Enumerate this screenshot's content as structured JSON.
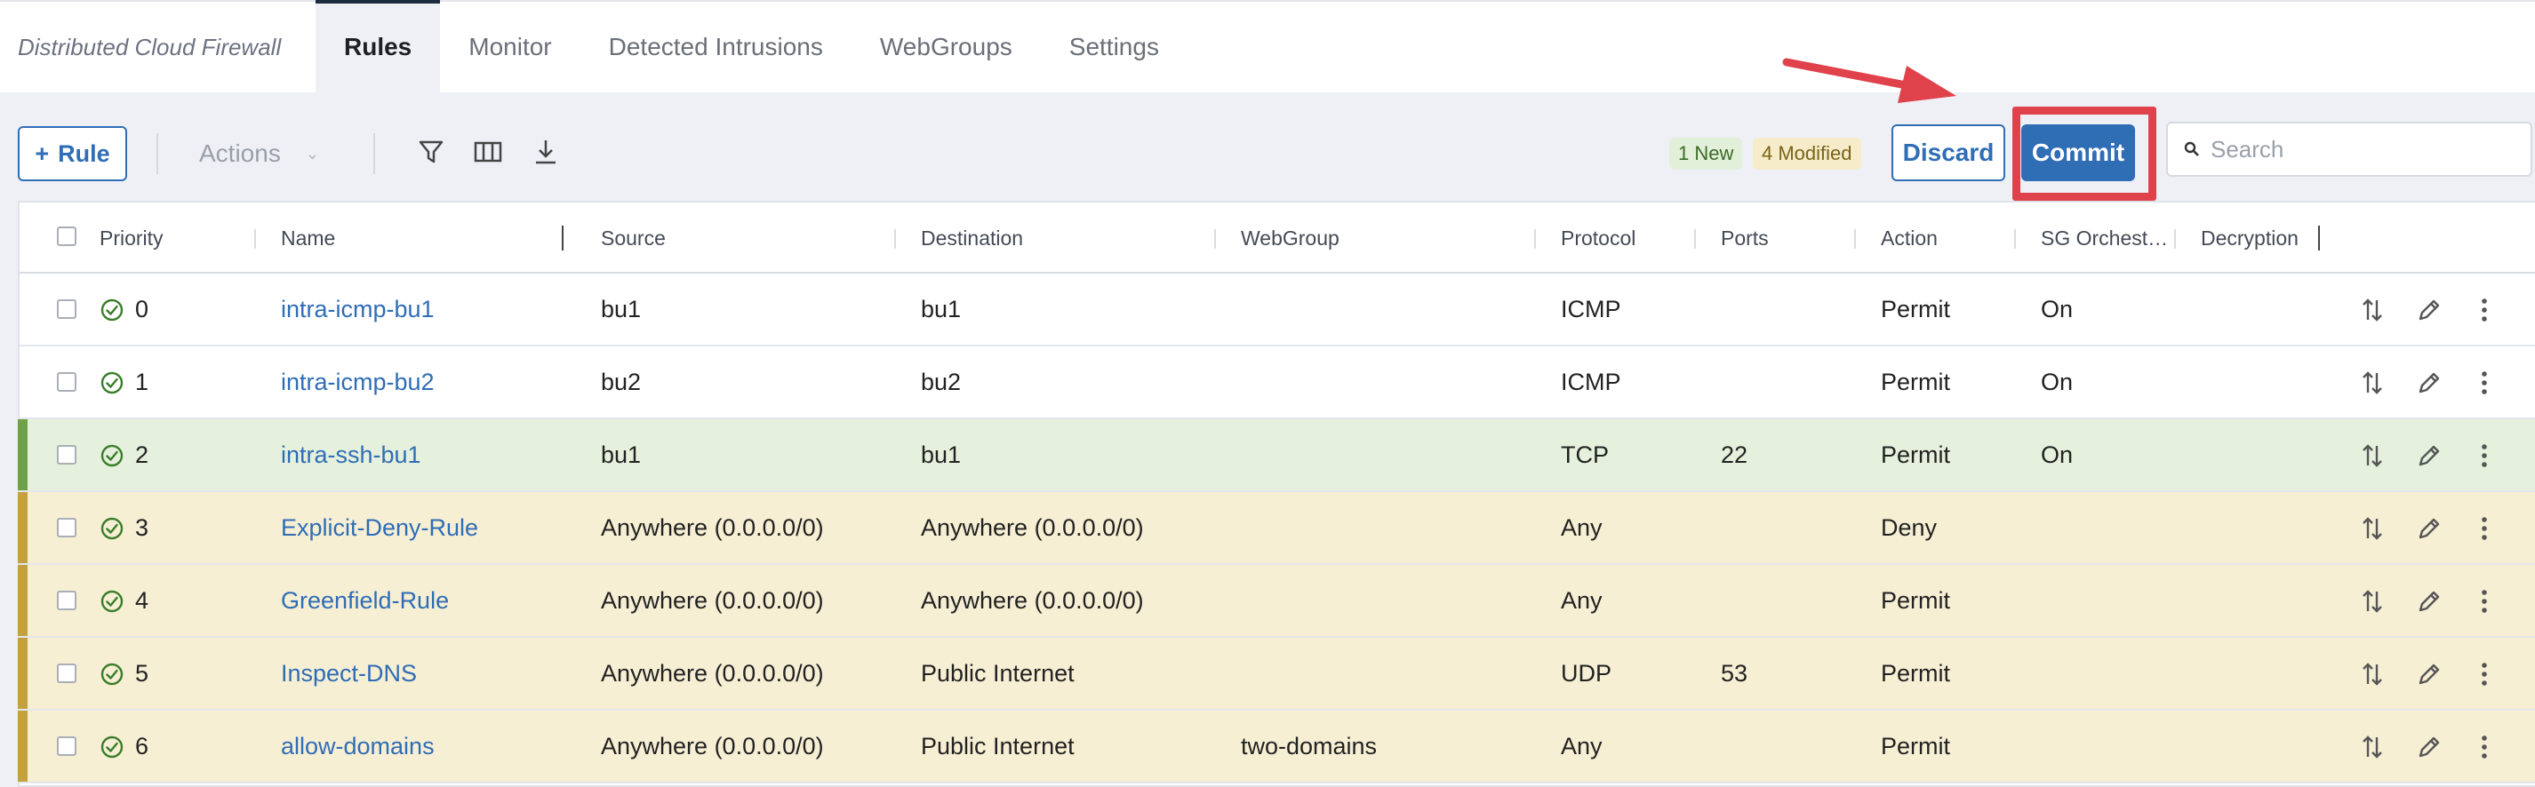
{
  "nav": {
    "brand": "Distributed Cloud Firewall",
    "tabs": [
      {
        "label": "Rules",
        "active": true
      },
      {
        "label": "Monitor"
      },
      {
        "label": "Detected Intrusions"
      },
      {
        "label": "WebGroups"
      },
      {
        "label": "Settings"
      }
    ]
  },
  "toolbar": {
    "rule_button": "Rule",
    "actions_label": "Actions",
    "badge_new": "1 New",
    "badge_modified": "4 Modified",
    "discard_label": "Discard",
    "commit_label": "Commit",
    "search_placeholder": "Search",
    "icons": [
      "filter-icon",
      "columns-icon",
      "download-icon"
    ]
  },
  "colors": {
    "accent": "#2f6db5",
    "new_row": "#e5f1dc",
    "modified_row": "#f7efd4",
    "annotation": "#e0424c"
  },
  "table": {
    "columns": [
      "Priority",
      "Name",
      "Source",
      "Destination",
      "WebGroup",
      "Protocol",
      "Ports",
      "Action",
      "SG Orchest…",
      "Decryption"
    ],
    "rows": [
      {
        "priority": "0",
        "name": "intra-icmp-bu1",
        "source": "bu1",
        "destination": "bu1",
        "webgroup": "",
        "protocol": "ICMP",
        "ports": "",
        "action": "Permit",
        "sg": "On",
        "state": "normal"
      },
      {
        "priority": "1",
        "name": "intra-icmp-bu2",
        "source": "bu2",
        "destination": "bu2",
        "webgroup": "",
        "protocol": "ICMP",
        "ports": "",
        "action": "Permit",
        "sg": "On",
        "state": "normal"
      },
      {
        "priority": "2",
        "name": "intra-ssh-bu1",
        "source": "bu1",
        "destination": "bu1",
        "webgroup": "",
        "protocol": "TCP",
        "ports": "22",
        "action": "Permit",
        "sg": "On",
        "state": "new"
      },
      {
        "priority": "3",
        "name": "Explicit-Deny-Rule",
        "source": "Anywhere (0.0.0.0/0)",
        "destination": "Anywhere (0.0.0.0/0)",
        "webgroup": "",
        "protocol": "Any",
        "ports": "",
        "action": "Deny",
        "sg": "",
        "state": "mod"
      },
      {
        "priority": "4",
        "name": "Greenfield-Rule",
        "source": "Anywhere (0.0.0.0/0)",
        "destination": "Anywhere (0.0.0.0/0)",
        "webgroup": "",
        "protocol": "Any",
        "ports": "",
        "action": "Permit",
        "sg": "",
        "state": "mod"
      },
      {
        "priority": "5",
        "name": "Inspect-DNS",
        "source": "Anywhere (0.0.0.0/0)",
        "destination": "Public Internet",
        "webgroup": "",
        "protocol": "UDP",
        "ports": "53",
        "action": "Permit",
        "sg": "",
        "state": "mod"
      },
      {
        "priority": "6",
        "name": "allow-domains",
        "source": "Anywhere (0.0.0.0/0)",
        "destination": "Public Internet",
        "webgroup": "two-domains",
        "protocol": "Any",
        "ports": "",
        "action": "Permit",
        "sg": "",
        "state": "mod"
      }
    ]
  }
}
